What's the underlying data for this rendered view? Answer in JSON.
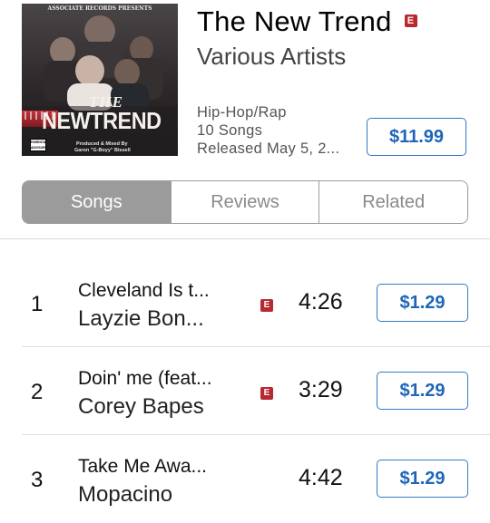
{
  "album": {
    "title": "The New Trend",
    "explicit_label": "E",
    "artist": "Various Artists",
    "genre": "Hip-Hop/Rap",
    "song_count": "10 Songs",
    "released": "Released May 5, 2...",
    "price": "$11.99",
    "cover_text": {
      "top_line": "ASSOCIATE RECORDS PRESENTS",
      "the": "THE",
      "title": "NEWTREND",
      "advisory": "PARENTAL ADVISORY",
      "credits_1": "Produced & Mixed By",
      "credits_2": "Garon \"G-Boyy\" Bissell"
    },
    "colors": {
      "explicit": "#b8282f",
      "price_blue": "#1f66b8"
    }
  },
  "tabs": [
    {
      "label": "Songs",
      "active": true
    },
    {
      "label": "Reviews",
      "active": false
    },
    {
      "label": "Related",
      "active": false
    }
  ],
  "tracks": [
    {
      "number": "1",
      "name": "Cleveland Is t...",
      "artist": "Layzie Bon...",
      "explicit": true,
      "explicit_label": "E",
      "duration": "4:26",
      "price": "$1.29"
    },
    {
      "number": "2",
      "name": "Doin' me (feat...",
      "artist": "Corey Bapes",
      "explicit": true,
      "explicit_label": "E",
      "duration": "3:29",
      "price": "$1.29"
    },
    {
      "number": "3",
      "name": "Take Me Awa...",
      "artist": "Mopacino",
      "explicit": false,
      "explicit_label": "",
      "duration": "4:42",
      "price": "$1.29"
    }
  ]
}
